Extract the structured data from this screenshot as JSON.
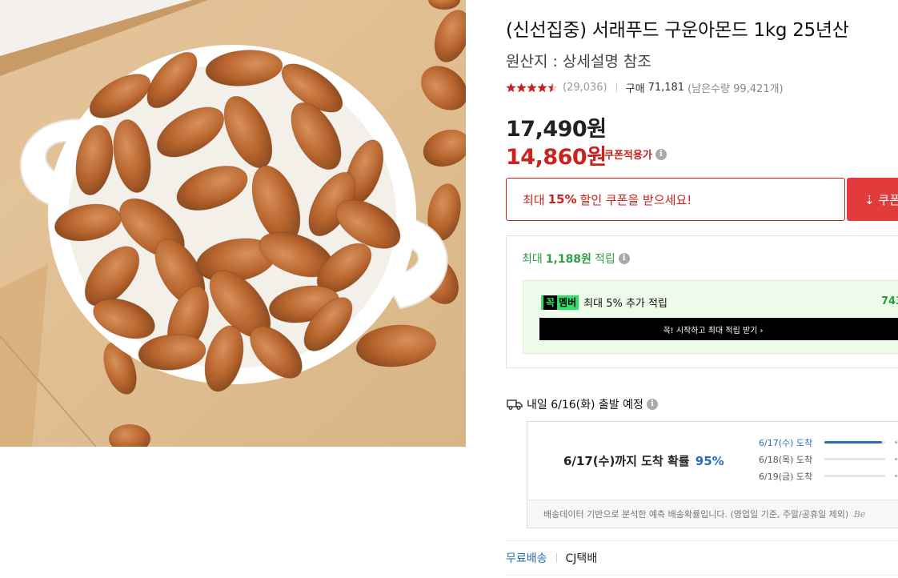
{
  "product": {
    "title": "(신선집중) 서래푸드 구운아몬드 1kg 25년산",
    "origin": "원산지 : 상세설명 참조",
    "image_alt": "구운아몬드"
  },
  "rating": {
    "stars": 4.5,
    "review_count": "(29,036)",
    "purchase_label": "구매",
    "purchase_count": "71,181",
    "stock": "(남은수량 99,421개)"
  },
  "price": {
    "original": "17,490원",
    "sale": "14,860원",
    "coupon_label": "쿠폰적용가",
    "info_icon": "i"
  },
  "coupon": {
    "prefix": "최대",
    "percent": "15%",
    "suffix": "할인 쿠폰을 받으세요!",
    "download_label": "⇣ 쿠폰"
  },
  "reward": {
    "prefix": "최대",
    "amount": "1,188원",
    "suffix": "적립",
    "member_badge_a": "꼭",
    "member_badge_b": "멤버",
    "member_desc": "최대 5% 추가 적립",
    "member_amount": "743",
    "member_cta": "꼭! 시작하고 최대 적립 받기 ›"
  },
  "shipping": {
    "departure": "내일 6/16(화) 출발 예정",
    "arrival_main": "6/17(수)까지 도착 확률",
    "arrival_prob": "95%",
    "arrival_rows": [
      {
        "label": "6/17(수) 도착",
        "fraction": 0.95,
        "highlight": true
      },
      {
        "label": "6/18(목) 도착",
        "fraction": 0.0,
        "highlight": false
      },
      {
        "label": "6/19(금) 도착",
        "fraction": 0.0,
        "highlight": false
      }
    ],
    "note": "배송데이터 기반으로 분석한 예측 배송확률입니다. (영업일 기준, 주말/공휴일 제외)",
    "note_tail": "Be",
    "free_shipping": "무료배송",
    "carrier": "CJ택배"
  },
  "colors": {
    "accent_red": "#c8231e",
    "accent_green": "#2f9e44",
    "accent_blue": "#2a6bb8",
    "member_green": "#2ee06a"
  }
}
